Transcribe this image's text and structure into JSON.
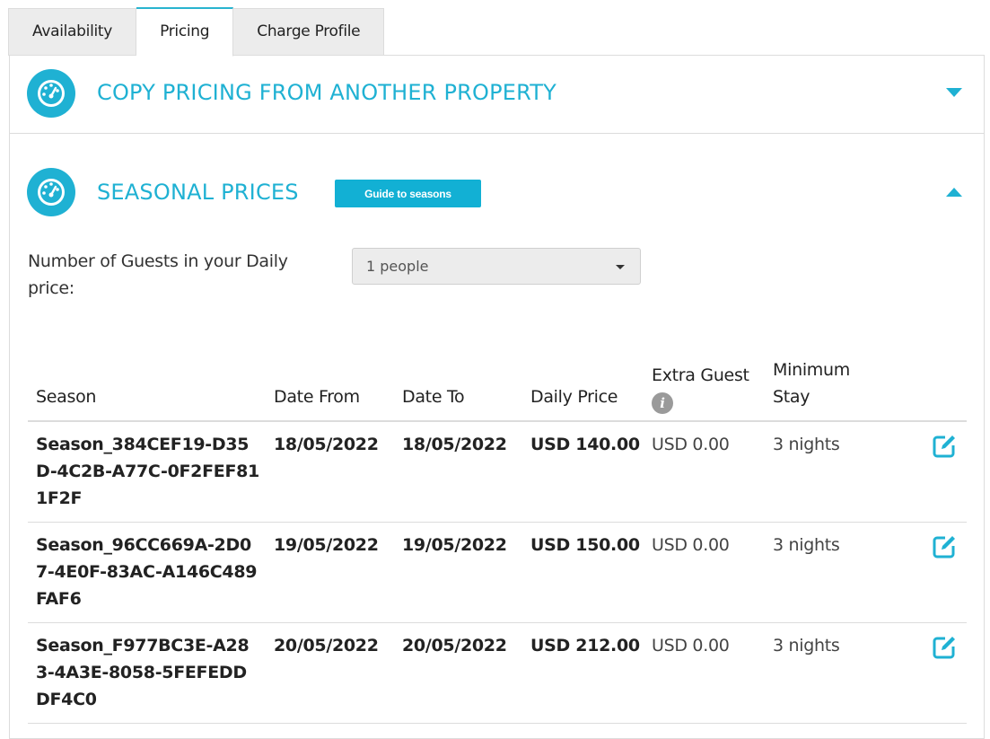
{
  "tabs": [
    {
      "label": "Availability"
    },
    {
      "label": "Pricing"
    },
    {
      "label": "Charge Profile"
    }
  ],
  "sections": {
    "copy_pricing": {
      "title": "COPY PRICING FROM ANOTHER PROPERTY",
      "icon": "speedometer-icon",
      "state": "collapsed"
    },
    "seasonal_prices": {
      "title": "SEASONAL PRICES",
      "icon": "speedometer-icon",
      "state": "expanded",
      "guide_button": "Guide to seasons"
    }
  },
  "guests": {
    "label": "Number of Guests in your Daily price:",
    "selected": "1 people"
  },
  "table": {
    "headers": {
      "season": "Season",
      "date_from": "Date From",
      "date_to": "Date To",
      "daily_price": "Daily Price",
      "extra_guest": "Extra Guest",
      "min_stay": "Minimum Stay"
    },
    "rows": [
      {
        "season": "Season_384CEF19-D35D-4C2B-A77C-0F2FEF811F2F",
        "date_from": "18/05/2022",
        "date_to": "18/05/2022",
        "daily_price": "USD 140.00",
        "extra_guest": "USD 0.00",
        "min_stay": "3 nights"
      },
      {
        "season": "Season_96CC669A-2D07-4E0F-83AC-A146C489FAF6",
        "date_from": "19/05/2022",
        "date_to": "19/05/2022",
        "daily_price": "USD 150.00",
        "extra_guest": "USD 0.00",
        "min_stay": "3 nights"
      },
      {
        "season": "Season_F977BC3E-A283-4A3E-8058-5FEFEDDDF4C0",
        "date_from": "20/05/2022",
        "date_to": "20/05/2022",
        "daily_price": "USD 212.00",
        "extra_guest": "USD 0.00",
        "min_stay": "3 nights"
      }
    ]
  },
  "colors": {
    "accent": "#1fb1d3",
    "button": "#12b0d4",
    "tab_bg": "#ececec",
    "border": "#dcdcdc"
  }
}
